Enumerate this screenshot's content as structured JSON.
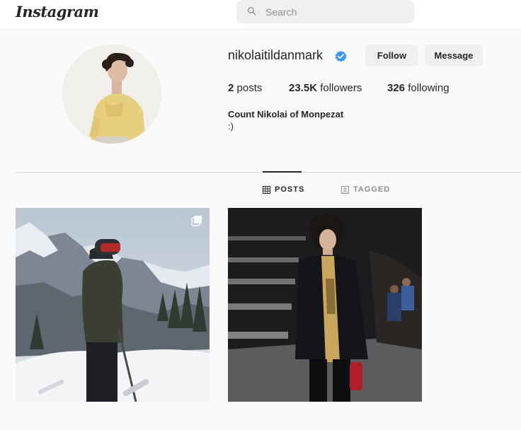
{
  "header": {
    "logo": "Instagram",
    "search_placeholder": "Search"
  },
  "profile": {
    "username": "nikolaitildanmark",
    "verified": true,
    "follow_label": "Follow",
    "message_label": "Message",
    "stats": {
      "posts_count": "2",
      "posts_label": "posts",
      "followers_count": "23.5K",
      "followers_label": "followers",
      "following_count": "326",
      "following_label": "following"
    },
    "full_name": "Count Nikolai of Monpezat",
    "bio": ":)"
  },
  "tabs": [
    {
      "label": "POSTS",
      "active": true
    },
    {
      "label": "TAGGED",
      "active": false
    }
  ],
  "posts": [
    {
      "multiple": true
    },
    {
      "multiple": false
    }
  ],
  "colors": {
    "verified_blue": "#3897f0",
    "text": "#262626",
    "muted": "#8e8e8e",
    "button_bg": "#efefef"
  }
}
